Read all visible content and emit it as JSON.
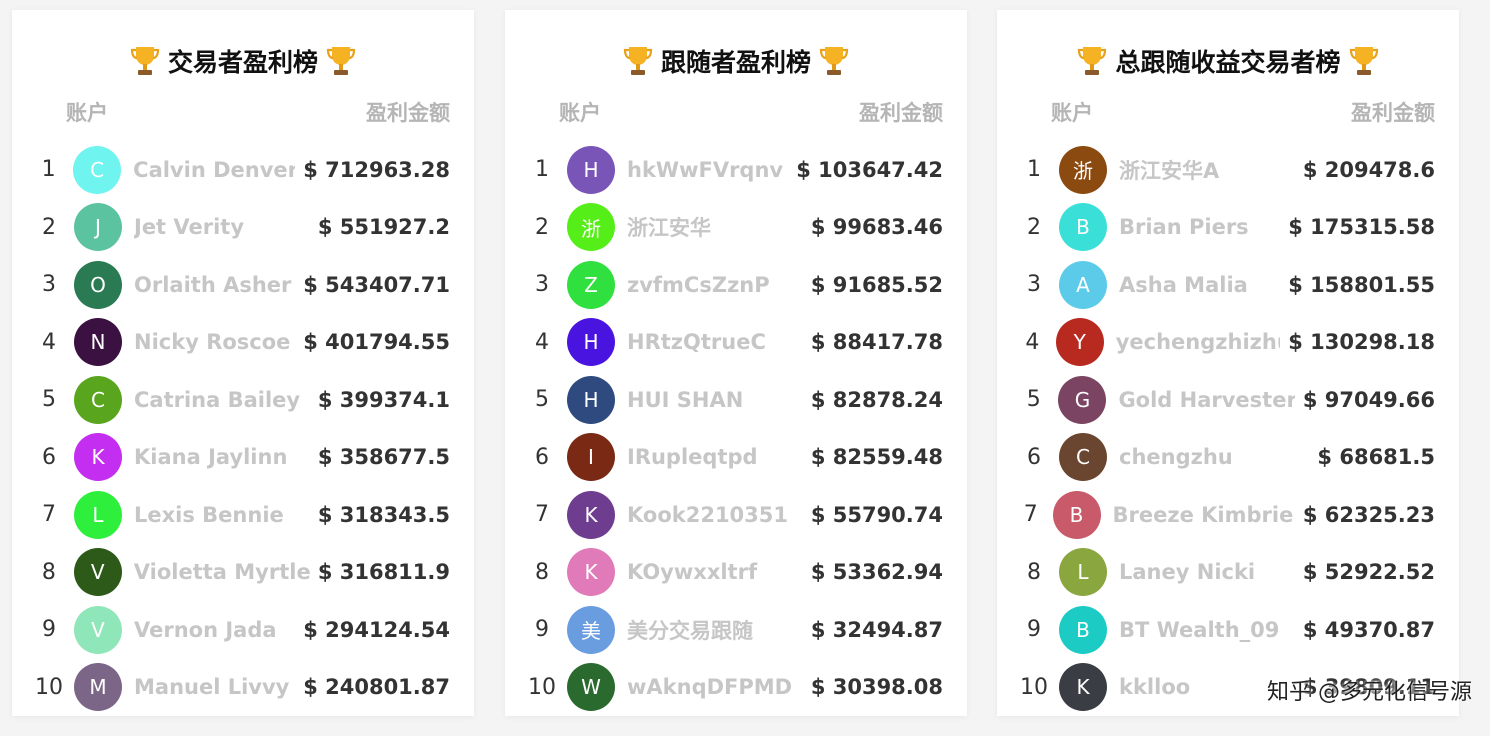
{
  "boards": [
    {
      "title": "交易者盈利榜",
      "col_account": "账户",
      "col_profit": "盈利金额",
      "rows": [
        {
          "rank": "1",
          "initial": "C",
          "color": "#6ff4ef",
          "name": "Calvin Denver",
          "amount": "$ 712963.28"
        },
        {
          "rank": "2",
          "initial": "J",
          "color": "#5cc3a0",
          "name": "Jet Verity",
          "amount": "$ 551927.2"
        },
        {
          "rank": "3",
          "initial": "O",
          "color": "#2a7a54",
          "name": "Orlaith Asher",
          "amount": "$ 543407.71"
        },
        {
          "rank": "4",
          "initial": "N",
          "color": "#3a1140",
          "name": "Nicky Roscoe",
          "amount": "$ 401794.55"
        },
        {
          "rank": "5",
          "initial": "C",
          "color": "#5aa51e",
          "name": "Catrina Bailey",
          "amount": "$ 399374.1"
        },
        {
          "rank": "6",
          "initial": "K",
          "color": "#c42ef0",
          "name": "Kiana Jaylinn",
          "amount": "$ 358677.5"
        },
        {
          "rank": "7",
          "initial": "L",
          "color": "#2ef03c",
          "name": "Lexis Bennie",
          "amount": "$ 318343.5"
        },
        {
          "rank": "8",
          "initial": "V",
          "color": "#2d5a18",
          "name": "Violetta Myrtle",
          "amount": "$ 316811.9"
        },
        {
          "rank": "9",
          "initial": "V",
          "color": "#8fe6b8",
          "name": "Vernon Jada",
          "amount": "$ 294124.54"
        },
        {
          "rank": "10",
          "initial": "M",
          "color": "#7c6688",
          "name": "Manuel Livvy",
          "amount": "$ 240801.87"
        }
      ]
    },
    {
      "title": "跟随者盈利榜",
      "col_account": "账户",
      "col_profit": "盈利金额",
      "rows": [
        {
          "rank": "1",
          "initial": "H",
          "color": "#7a55b8",
          "name": "hkWwFVrqnv",
          "amount": "$ 103647.42"
        },
        {
          "rank": "2",
          "initial": "浙",
          "color": "#56ee18",
          "name": "浙江安华",
          "amount": "$ 99683.46"
        },
        {
          "rank": "3",
          "initial": "Z",
          "color": "#2fe03e",
          "name": "zvfmCsZznP",
          "amount": "$ 91685.52"
        },
        {
          "rank": "4",
          "initial": "H",
          "color": "#4a14e0",
          "name": "HRtzQtrueC",
          "amount": "$ 88417.78"
        },
        {
          "rank": "5",
          "initial": "H",
          "color": "#2e4a7e",
          "name": "HUI SHAN",
          "amount": "$ 82878.24"
        },
        {
          "rank": "6",
          "initial": "I",
          "color": "#7a2a14",
          "name": "IRupleqtpd",
          "amount": "$ 82559.48"
        },
        {
          "rank": "7",
          "initial": "K",
          "color": "#6e3d90",
          "name": "Kook2210351",
          "amount": "$ 55790.74"
        },
        {
          "rank": "8",
          "initial": "K",
          "color": "#e07ab8",
          "name": "KOywxxltrf",
          "amount": "$ 53362.94"
        },
        {
          "rank": "9",
          "initial": "美",
          "color": "#6a9de0",
          "name": "美分交易跟随",
          "amount": "$ 32494.87"
        },
        {
          "rank": "10",
          "initial": "W",
          "color": "#2a6a2e",
          "name": "wAknqDFPMD",
          "amount": "$ 30398.08"
        }
      ]
    },
    {
      "title": "总跟随收益交易者榜",
      "col_account": "账户",
      "col_profit": "盈利金额",
      "rows": [
        {
          "rank": "1",
          "initial": "浙",
          "color": "#8a4a10",
          "name": "浙江安华A",
          "amount": "$ 209478.6"
        },
        {
          "rank": "2",
          "initial": "B",
          "color": "#3ae0d8",
          "name": "Brian Piers",
          "amount": "$ 175315.58"
        },
        {
          "rank": "3",
          "initial": "A",
          "color": "#5ccbea",
          "name": "Asha Malia",
          "amount": "$ 158801.55"
        },
        {
          "rank": "4",
          "initial": "Y",
          "color": "#b82a20",
          "name": "yechengzhizhu",
          "amount": "$ 130298.18"
        },
        {
          "rank": "5",
          "initial": "G",
          "color": "#7a4462",
          "name": "Gold Harvester",
          "amount": "$ 97049.66"
        },
        {
          "rank": "6",
          "initial": "C",
          "color": "#6a4630",
          "name": "chengzhu",
          "amount": "$ 68681.5"
        },
        {
          "rank": "7",
          "initial": "B",
          "color": "#c85a6a",
          "name": "Breeze Kimbriella",
          "amount": "$ 62325.23"
        },
        {
          "rank": "8",
          "initial": "L",
          "color": "#8aa63e",
          "name": "Laney Nicki",
          "amount": "$ 52922.52"
        },
        {
          "rank": "9",
          "initial": "B",
          "color": "#1ccbc4",
          "name": "BT Wealth_09",
          "amount": "$ 49370.87"
        },
        {
          "rank": "10",
          "initial": "K",
          "color": "#3a3e44",
          "name": "kklloo",
          "amount": "$ 39809.11"
        }
      ]
    }
  ],
  "watermark": "知乎 @多元化信号源"
}
